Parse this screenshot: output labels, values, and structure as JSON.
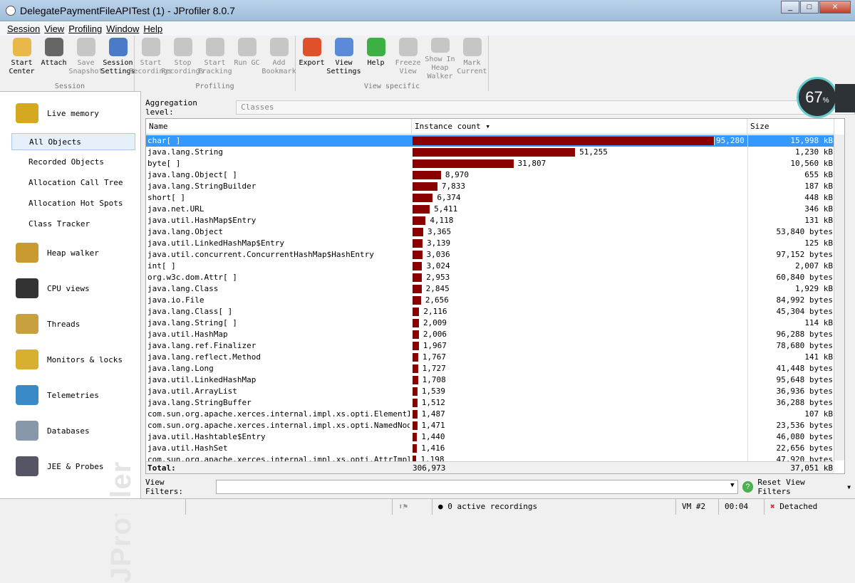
{
  "window": {
    "title": "DelegatePaymentFileAPITest (1) - JProfiler 8.0.7",
    "controls": [
      "_",
      "□",
      "✕"
    ]
  },
  "menu": [
    "Session",
    "View",
    "Profiling",
    "Window",
    "Help"
  ],
  "toolbar": {
    "groups": [
      {
        "label": "Session",
        "buttons": [
          {
            "l1": "Start",
            "l2": "Center",
            "icon": "folder-gear-icon",
            "color": "#e8b84a",
            "enabled": true
          },
          {
            "l1": "Attach",
            "l2": "",
            "icon": "plug-icon",
            "color": "#666",
            "enabled": true
          },
          {
            "l1": "Save",
            "l2": "Snapshot",
            "icon": "floppy-icon",
            "color": "#aaa",
            "enabled": false
          },
          {
            "l1": "Session",
            "l2": "Settings",
            "icon": "clipboard-icon",
            "color": "#4a7ac8",
            "enabled": true
          }
        ]
      },
      {
        "label": "Profiling",
        "buttons": [
          {
            "l1": "Start",
            "l2": "Recordings",
            "icon": "record-icon",
            "enabled": false
          },
          {
            "l1": "Stop",
            "l2": "Recordings",
            "icon": "stop-record-icon",
            "enabled": false
          },
          {
            "l1": "Start",
            "l2": "Tracking",
            "icon": "tracking-icon",
            "enabled": false
          },
          {
            "l1": "Run GC",
            "l2": "",
            "icon": "recycle-icon",
            "enabled": false
          },
          {
            "l1": "Add",
            "l2": "Bookmark",
            "icon": "bookmark-icon",
            "enabled": false
          }
        ]
      },
      {
        "label": "View specific",
        "buttons": [
          {
            "l1": "Export",
            "l2": "",
            "icon": "export-icon",
            "color": "#e0502a",
            "enabled": true
          },
          {
            "l1": "View",
            "l2": "Settings",
            "icon": "view-settings-icon",
            "color": "#5a8ad8",
            "enabled": true
          },
          {
            "l1": "Help",
            "l2": "",
            "icon": "help-icon",
            "color": "#3cb043",
            "enabled": true
          },
          {
            "l1": "Freeze",
            "l2": "View",
            "icon": "snowflake-icon",
            "enabled": false
          },
          {
            "l1": "Show In",
            "l2": "Heap Walker",
            "icon": "heap-walker-icon",
            "enabled": false
          },
          {
            "l1": "Mark",
            "l2": "Current",
            "icon": "mark-icon",
            "enabled": false
          }
        ]
      }
    ]
  },
  "sidebar": {
    "watermark": "JProfiler",
    "sections": [
      {
        "label": "Live memory",
        "icon": "live-memory-icon",
        "color": "#d4a820"
      },
      {
        "label": "Heap walker",
        "icon": "heap-walker-icon",
        "color": "#c89a30"
      },
      {
        "label": "CPU views",
        "icon": "cpu-icon",
        "color": "#333"
      },
      {
        "label": "Threads",
        "icon": "threads-icon",
        "color": "#c8a040"
      },
      {
        "label": "Monitors & locks",
        "icon": "lock-icon",
        "color": "#d8b030"
      },
      {
        "label": "Telemetries",
        "icon": "telemetries-icon",
        "color": "#3a8ac8"
      },
      {
        "label": "Databases",
        "icon": "database-icon",
        "color": "#8898a8"
      },
      {
        "label": "JEE & Probes",
        "icon": "probes-icon",
        "color": "#556"
      }
    ],
    "live_memory_items": [
      "All Objects",
      "Recorded Objects",
      "Allocation Call Tree",
      "Allocation Hot Spots",
      "Class Tracker"
    ],
    "selected": "All Objects"
  },
  "aggregation": {
    "label": "Aggregation level:",
    "value": "Classes"
  },
  "table": {
    "columns": [
      "Name",
      "Instance count ▾",
      "Size"
    ],
    "rows": [
      [
        "char[ ]",
        95280,
        "95,280",
        "15,998 kB"
      ],
      [
        "java.lang.String",
        51255,
        "51,255",
        "1,230 kB"
      ],
      [
        "byte[ ]",
        31807,
        "31,807",
        "10,560 kB"
      ],
      [
        "java.lang.Object[ ]",
        8970,
        "8,970",
        "655 kB"
      ],
      [
        "java.lang.StringBuilder",
        7833,
        "7,833",
        "187 kB"
      ],
      [
        "short[ ]",
        6374,
        "6,374",
        "448 kB"
      ],
      [
        "java.net.URL",
        5411,
        "5,411",
        "346 kB"
      ],
      [
        "java.util.HashMap$Entry",
        4118,
        "4,118",
        "131 kB"
      ],
      [
        "java.lang.Object",
        3365,
        "3,365",
        "53,840 bytes"
      ],
      [
        "java.util.LinkedHashMap$Entry",
        3139,
        "3,139",
        "125 kB"
      ],
      [
        "java.util.concurrent.ConcurrentHashMap$HashEntry",
        3036,
        "3,036",
        "97,152 bytes"
      ],
      [
        "int[ ]",
        3024,
        "3,024",
        "2,007 kB"
      ],
      [
        "org.w3c.dom.Attr[ ]",
        2953,
        "2,953",
        "60,840 bytes"
      ],
      [
        "java.lang.Class",
        2845,
        "2,845",
        "1,929 kB"
      ],
      [
        "java.io.File",
        2656,
        "2,656",
        "84,992 bytes"
      ],
      [
        "java.lang.Class[ ]",
        2116,
        "2,116",
        "45,304 bytes"
      ],
      [
        "java.lang.String[ ]",
        2009,
        "2,009",
        "114 kB"
      ],
      [
        "java.util.HashMap",
        2006,
        "2,006",
        "96,288 bytes"
      ],
      [
        "java.lang.ref.Finalizer",
        1967,
        "1,967",
        "78,680 bytes"
      ],
      [
        "java.lang.reflect.Method",
        1767,
        "1,767",
        "141 kB"
      ],
      [
        "java.lang.Long",
        1727,
        "1,727",
        "41,448 bytes"
      ],
      [
        "java.util.LinkedHashMap",
        1708,
        "1,708",
        "95,648 bytes"
      ],
      [
        "java.util.ArrayList",
        1539,
        "1,539",
        "36,936 bytes"
      ],
      [
        "java.lang.StringBuffer",
        1512,
        "1,512",
        "36,288 bytes"
      ],
      [
        "com.sun.org.apache.xerces.internal.impl.xs.opti.ElementImpl",
        1487,
        "1,487",
        "107 kB"
      ],
      [
        "com.sun.org.apache.xerces.internal.impl.xs.opti.NamedNodeM...",
        1471,
        "1,471",
        "23,536 bytes"
      ],
      [
        "java.util.Hashtable$Entry",
        1440,
        "1,440",
        "46,080 bytes"
      ],
      [
        "java.util.HashSet",
        1416,
        "1,416",
        "22,656 bytes"
      ],
      [
        "com.sun.org.apache.xerces.internal.impl.xs.opti.AttrImpl",
        1198,
        "1,198",
        "47,920 bytes"
      ]
    ],
    "total": {
      "label": "Total:",
      "count": "306,973",
      "size": "37,051 kB"
    },
    "bar_color": "#8b0000",
    "selected_color": "#3399ff"
  },
  "filters": {
    "label": "View Filters:",
    "value": "",
    "reset": "Reset View Filters"
  },
  "status": {
    "recordings": "0 active recordings",
    "vm": "VM #2",
    "time": "00:04",
    "state": "Detached"
  },
  "gauge": {
    "value": "67",
    "unit": "%"
  }
}
